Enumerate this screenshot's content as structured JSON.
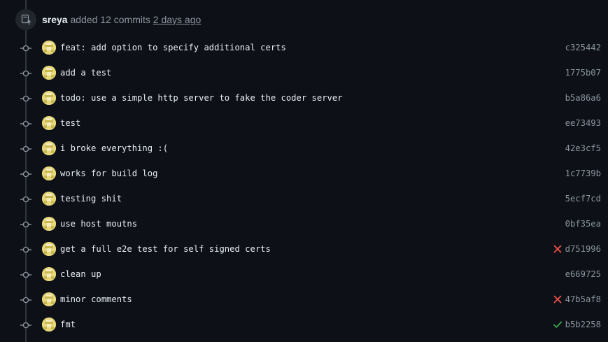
{
  "event": {
    "author": "sreya",
    "action": " added 12 commits ",
    "time": "2 days ago",
    "icon": "repo-push-icon"
  },
  "colors": {
    "background": "#0d1117",
    "muted": "#8b949e",
    "failure": "#f85149",
    "success": "#3fb950"
  },
  "commits": [
    {
      "message": "feat: add option to specify additional certs",
      "sha": "c325442",
      "status": "none"
    },
    {
      "message": "add a test",
      "sha": "1775b07",
      "status": "none"
    },
    {
      "message": "todo: use a simple http server to fake the coder server",
      "sha": "b5a86a6",
      "status": "none"
    },
    {
      "message": "test",
      "sha": "ee73493",
      "status": "none"
    },
    {
      "message": "i broke everything :(",
      "sha": "42e3cf5",
      "status": "none"
    },
    {
      "message": "works for build log",
      "sha": "1c7739b",
      "status": "none"
    },
    {
      "message": "testing shit",
      "sha": "5ecf7cd",
      "status": "none"
    },
    {
      "message": "use host moutns",
      "sha": "0bf35ea",
      "status": "none"
    },
    {
      "message": "get a full e2e test for self signed certs",
      "sha": "d751996",
      "status": "failure"
    },
    {
      "message": "clean up",
      "sha": "e669725",
      "status": "none"
    },
    {
      "message": "minor comments",
      "sha": "47b5af8",
      "status": "failure"
    },
    {
      "message": "fmt",
      "sha": "b5b2258",
      "status": "success"
    }
  ]
}
